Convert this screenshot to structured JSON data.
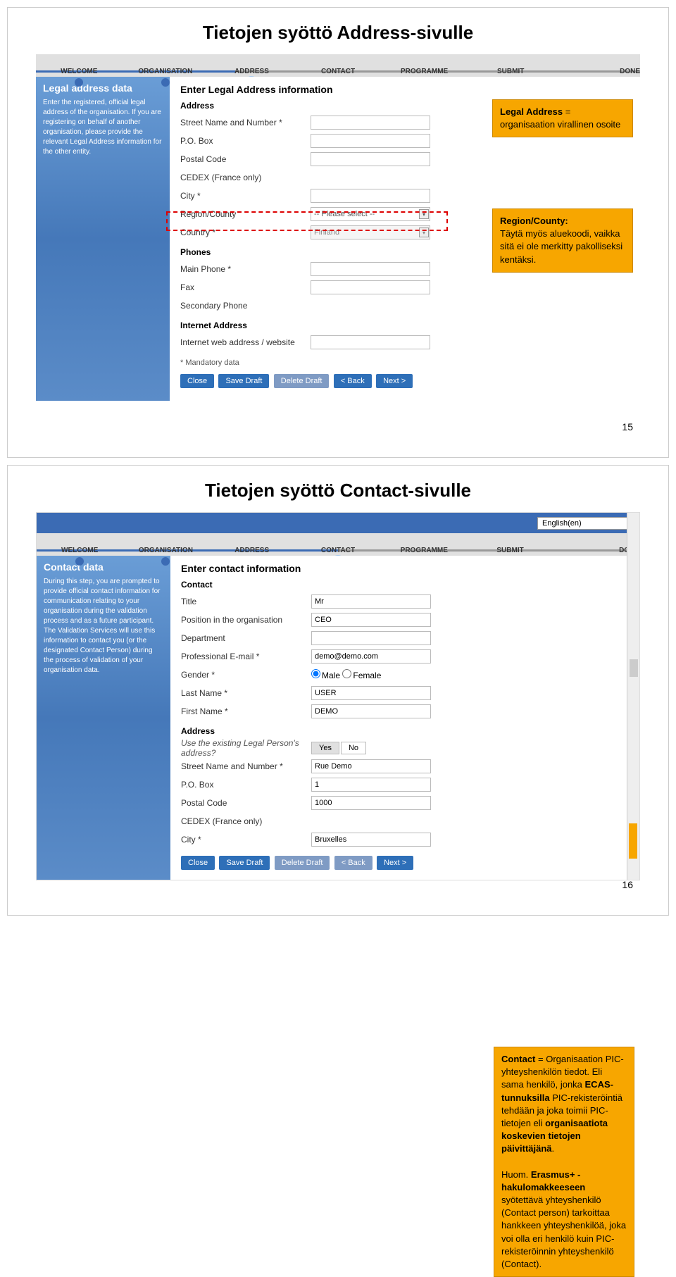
{
  "slide1": {
    "title": "Tietojen syöttö Address-sivulle",
    "steps": [
      "WELCOME",
      "ORGANISATION",
      "ADDRESS",
      "CONTACT",
      "PROGRAMME",
      "SUBMIT",
      "DONE"
    ],
    "sidebar_title": "Legal address data",
    "sidebar_text": "Enter the registered, official legal address of the organisation. If you are registering on behalf of another organisation, please provide the relevant Legal Address information for the other entity.",
    "form_title": "Enter Legal Address information",
    "section_address": "Address",
    "section_phones": "Phones",
    "section_internet": "Internet Address",
    "labels": {
      "street": "Street Name and Number *",
      "pobox": "P.O. Box",
      "postal": "Postal Code",
      "cedex": "CEDEX (France only)",
      "city": "City *",
      "region": "Region/County",
      "country": "Country *",
      "mainphone": "Main Phone *",
      "fax": "Fax",
      "secphone": "Secondary Phone",
      "website": "Internet web address / website"
    },
    "region_placeholder": "-- Please select --",
    "country_value": "Finland",
    "mandatory_note": "* Mandatory data",
    "buttons": {
      "close": "Close",
      "save": "Save Draft",
      "delete": "Delete Draft",
      "back": "< Back",
      "next": "Next >"
    },
    "callout1_title": "Legal Address",
    "callout1_text": " = organisaation virallinen osoite",
    "callout2_title": "Region/County:",
    "callout2_text": "Täytä myös aluekoodi, vaikka sitä ei ole merkitty pakolliseksi kentäksi.",
    "page_num": "15"
  },
  "slide2": {
    "title": "Tietojen syöttö Contact-sivulle",
    "lang": "English(en)",
    "steps": [
      "WELCOME",
      "ORGANISATION",
      "ADDRESS",
      "CONTACT",
      "PROGRAMME",
      "SUBMIT",
      "DONE"
    ],
    "sidebar_title": "Contact data",
    "sidebar_text": "During this step, you are prompted to provide official contact information for communication relating to your organisation during the validation process and as a future participant. The Validation Services will use this information to contact you (or the designated Contact Person) during the process of validation of your organisation data.",
    "form_title": "Enter contact information",
    "section_contact": "Contact",
    "section_address": "Address",
    "labels": {
      "title": "Title",
      "position": "Position in the organisation",
      "department": "Department",
      "email": "Professional E-mail *",
      "gender": "Gender *",
      "lastname": "Last Name *",
      "firstname": "First Name *",
      "useexisting": "Use the existing Legal Person's address?",
      "street": "Street Name and Number *",
      "pobox": "P.O. Box",
      "postal": "Postal Code",
      "cedex": "CEDEX (France only)",
      "city": "City *"
    },
    "values": {
      "title": "Mr",
      "position": "CEO",
      "email": "demo@demo.com",
      "gender_m": "Male",
      "gender_f": "Female",
      "lastname": "USER",
      "firstname": "DEMO",
      "yes": "Yes",
      "no": "No",
      "street": "Rue Demo",
      "pobox": "1",
      "postal": "1000",
      "city": "Bruxelles"
    },
    "buttons": {
      "close": "Close",
      "save": "Save Draft",
      "delete": "Delete Draft",
      "back": "< Back",
      "next": "Next >"
    },
    "callout_title": "Contact",
    "callout_text_1": " = Organisaation PIC-yhteyshenkilön tiedot. Eli sama henkilö, jonka ",
    "callout_bold_1": "ECAS-tunnuksilla",
    "callout_text_2": " PIC-rekisteröintiä tehdään ja joka toimii PIC-tietojen eli ",
    "callout_bold_2": "organisaatiota koskevien tietojen päivittäjänä",
    "callout_text_3": ".",
    "callout_text_4": "Huom. ",
    "callout_bold_3": "Erasmus+ -hakulomakkeeseen",
    "callout_text_5": " syötettävä yhteyshenkilö (Contact person) tarkoittaa hankkeen yhteyshenkilöä, joka voi olla eri henkilö kuin PIC-rekisteröinnin yhteyshenkilö (Contact).",
    "page_num": "16"
  }
}
